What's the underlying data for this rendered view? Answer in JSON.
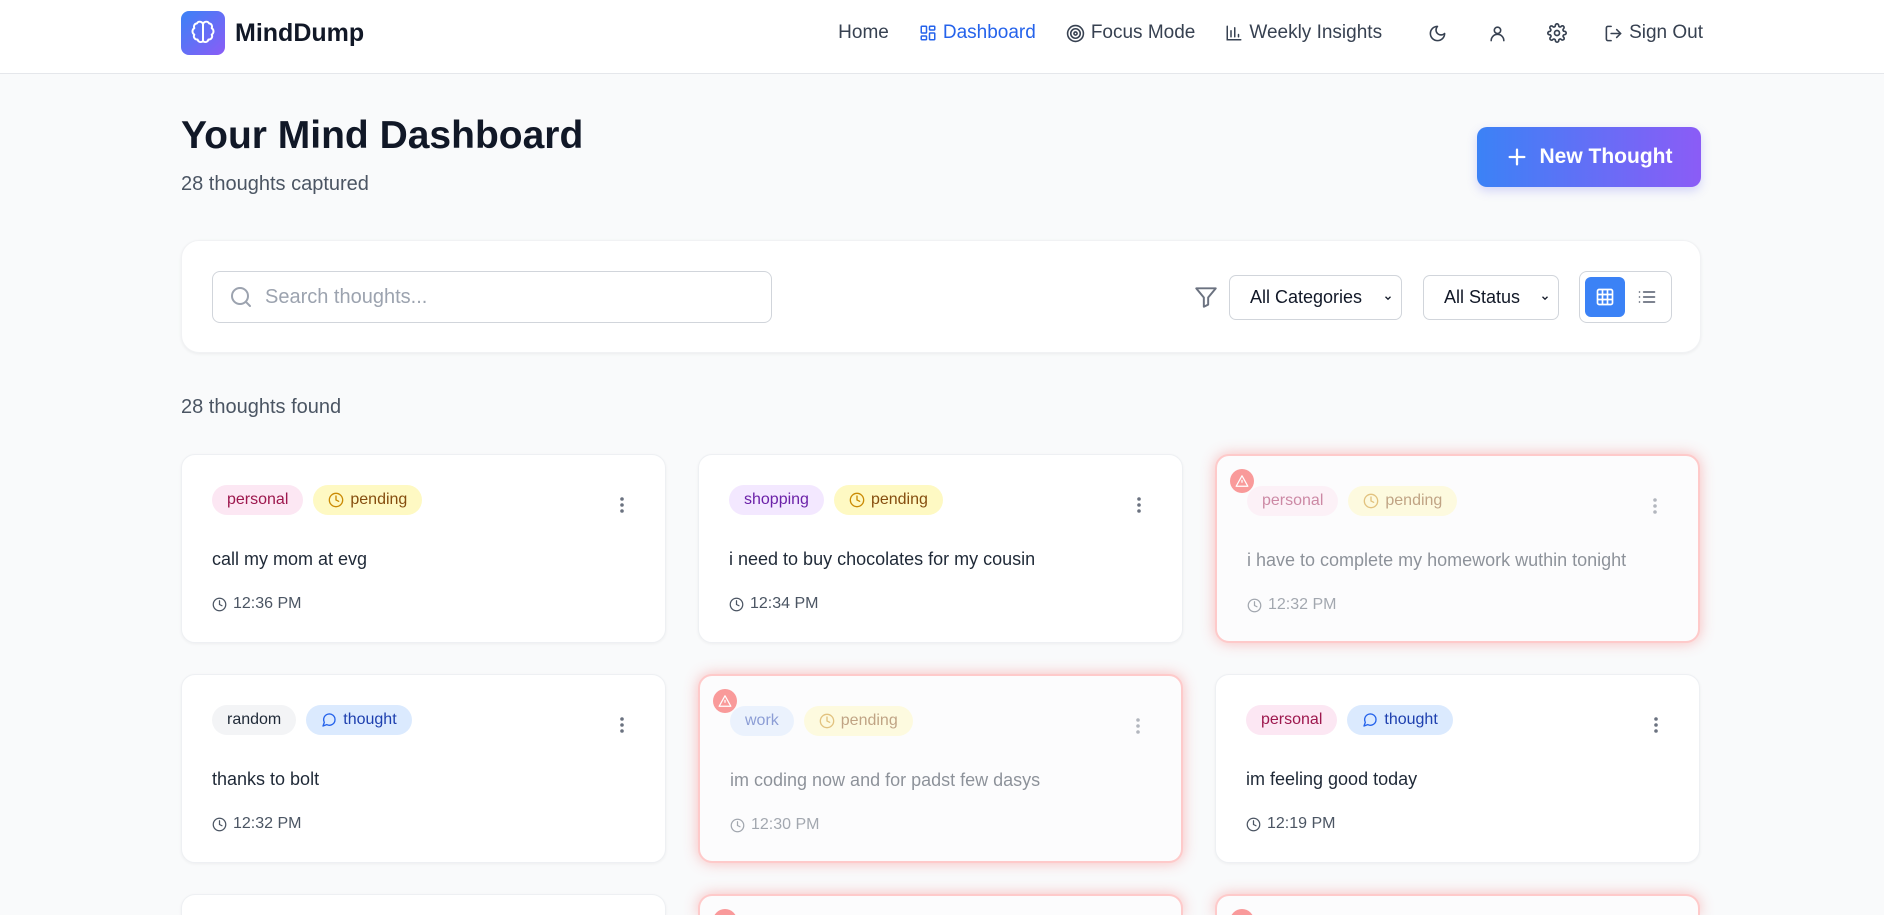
{
  "brand": {
    "name": "MindDump"
  },
  "nav": {
    "home": "Home",
    "dashboard": "Dashboard",
    "focus": "Focus Mode",
    "insights": "Weekly Insights",
    "signout": "Sign Out"
  },
  "header": {
    "title": "Your Mind Dashboard",
    "subtitle": "28 thoughts captured",
    "new_button": "New Thought"
  },
  "filters": {
    "search_placeholder": "Search thoughts...",
    "category": "All Categories",
    "status": "All Status",
    "view": "grid"
  },
  "results": {
    "found": "28 thoughts found"
  },
  "cards": [
    {
      "category": "personal",
      "status": "pending",
      "text": "call my mom at evg",
      "time": "12:36 PM",
      "urgent": false
    },
    {
      "category": "shopping",
      "status": "pending",
      "text": "i need to buy chocolates for my cousin",
      "time": "12:34 PM",
      "urgent": false
    },
    {
      "category": "personal",
      "status": "pending",
      "text": "i have to complete my homework wuthin tonight",
      "time": "12:32 PM",
      "urgent": true
    },
    {
      "category": "random",
      "status": "thought",
      "text": "thanks to bolt",
      "time": "12:32 PM",
      "urgent": false
    },
    {
      "category": "work",
      "status": "pending",
      "text": "im coding now and for padst few dasys",
      "time": "12:30 PM",
      "urgent": true
    },
    {
      "category": "personal",
      "status": "thought",
      "text": "im feeling good today",
      "time": "12:19 PM",
      "urgent": false
    }
  ],
  "colors": {
    "accent": "#2563eb",
    "gradient_start": "#3b82f6",
    "gradient_end": "#8b5cf6",
    "urgent_glow": "#f87171"
  }
}
